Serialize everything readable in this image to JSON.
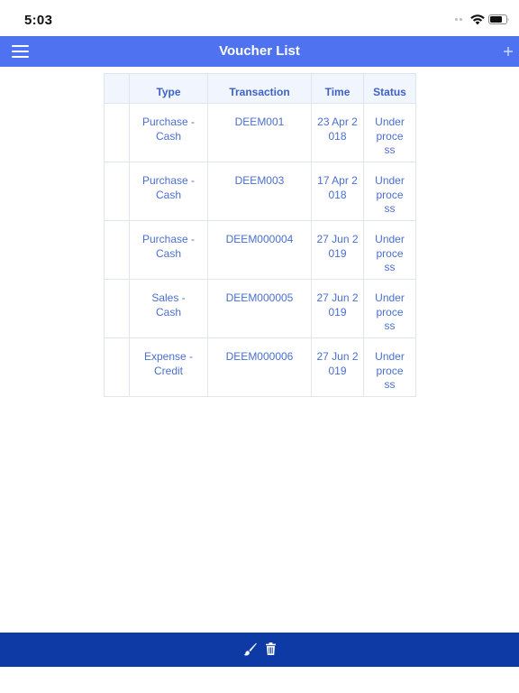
{
  "status_bar": {
    "time": "5:03",
    "icons": [
      "wifi-icon",
      "battery-icon"
    ]
  },
  "nav_bar": {
    "title": "Voucher List",
    "left_icon": "menu-icon",
    "right_icon": "add-icon"
  },
  "table": {
    "columns": [
      "",
      "Type",
      "Transaction",
      "Time",
      "Status"
    ],
    "rows": [
      {
        "type": "Purchase - Cash",
        "transaction": "DEEM001",
        "time": "23 Apr 2018",
        "status": "Under process"
      },
      {
        "type": "Purchase - Cash",
        "transaction": "DEEM003",
        "time": "17 Apr 2018",
        "status": "Under process"
      },
      {
        "type": "Purchase - Cash",
        "transaction": "DEEM000004",
        "time": "27 Jun 2019",
        "status": "Under process"
      },
      {
        "type": "Sales - Cash",
        "transaction": "DEEM000005",
        "time": "27 Jun 2019",
        "status": "Under process"
      },
      {
        "type": "Expense - Credit",
        "transaction": "DEEM000006",
        "time": "27 Jun 2019",
        "status": "Under process"
      }
    ]
  },
  "bottom_toolbar": {
    "icons": [
      "brush-icon",
      "trash-icon"
    ]
  },
  "colors": {
    "nav_bar": "#4f73f0",
    "bottom_toolbar": "#0e3aa6",
    "table_text": "#4a6fcf",
    "header_bg": "#f1f5fd",
    "border": "#dfe4ee"
  }
}
